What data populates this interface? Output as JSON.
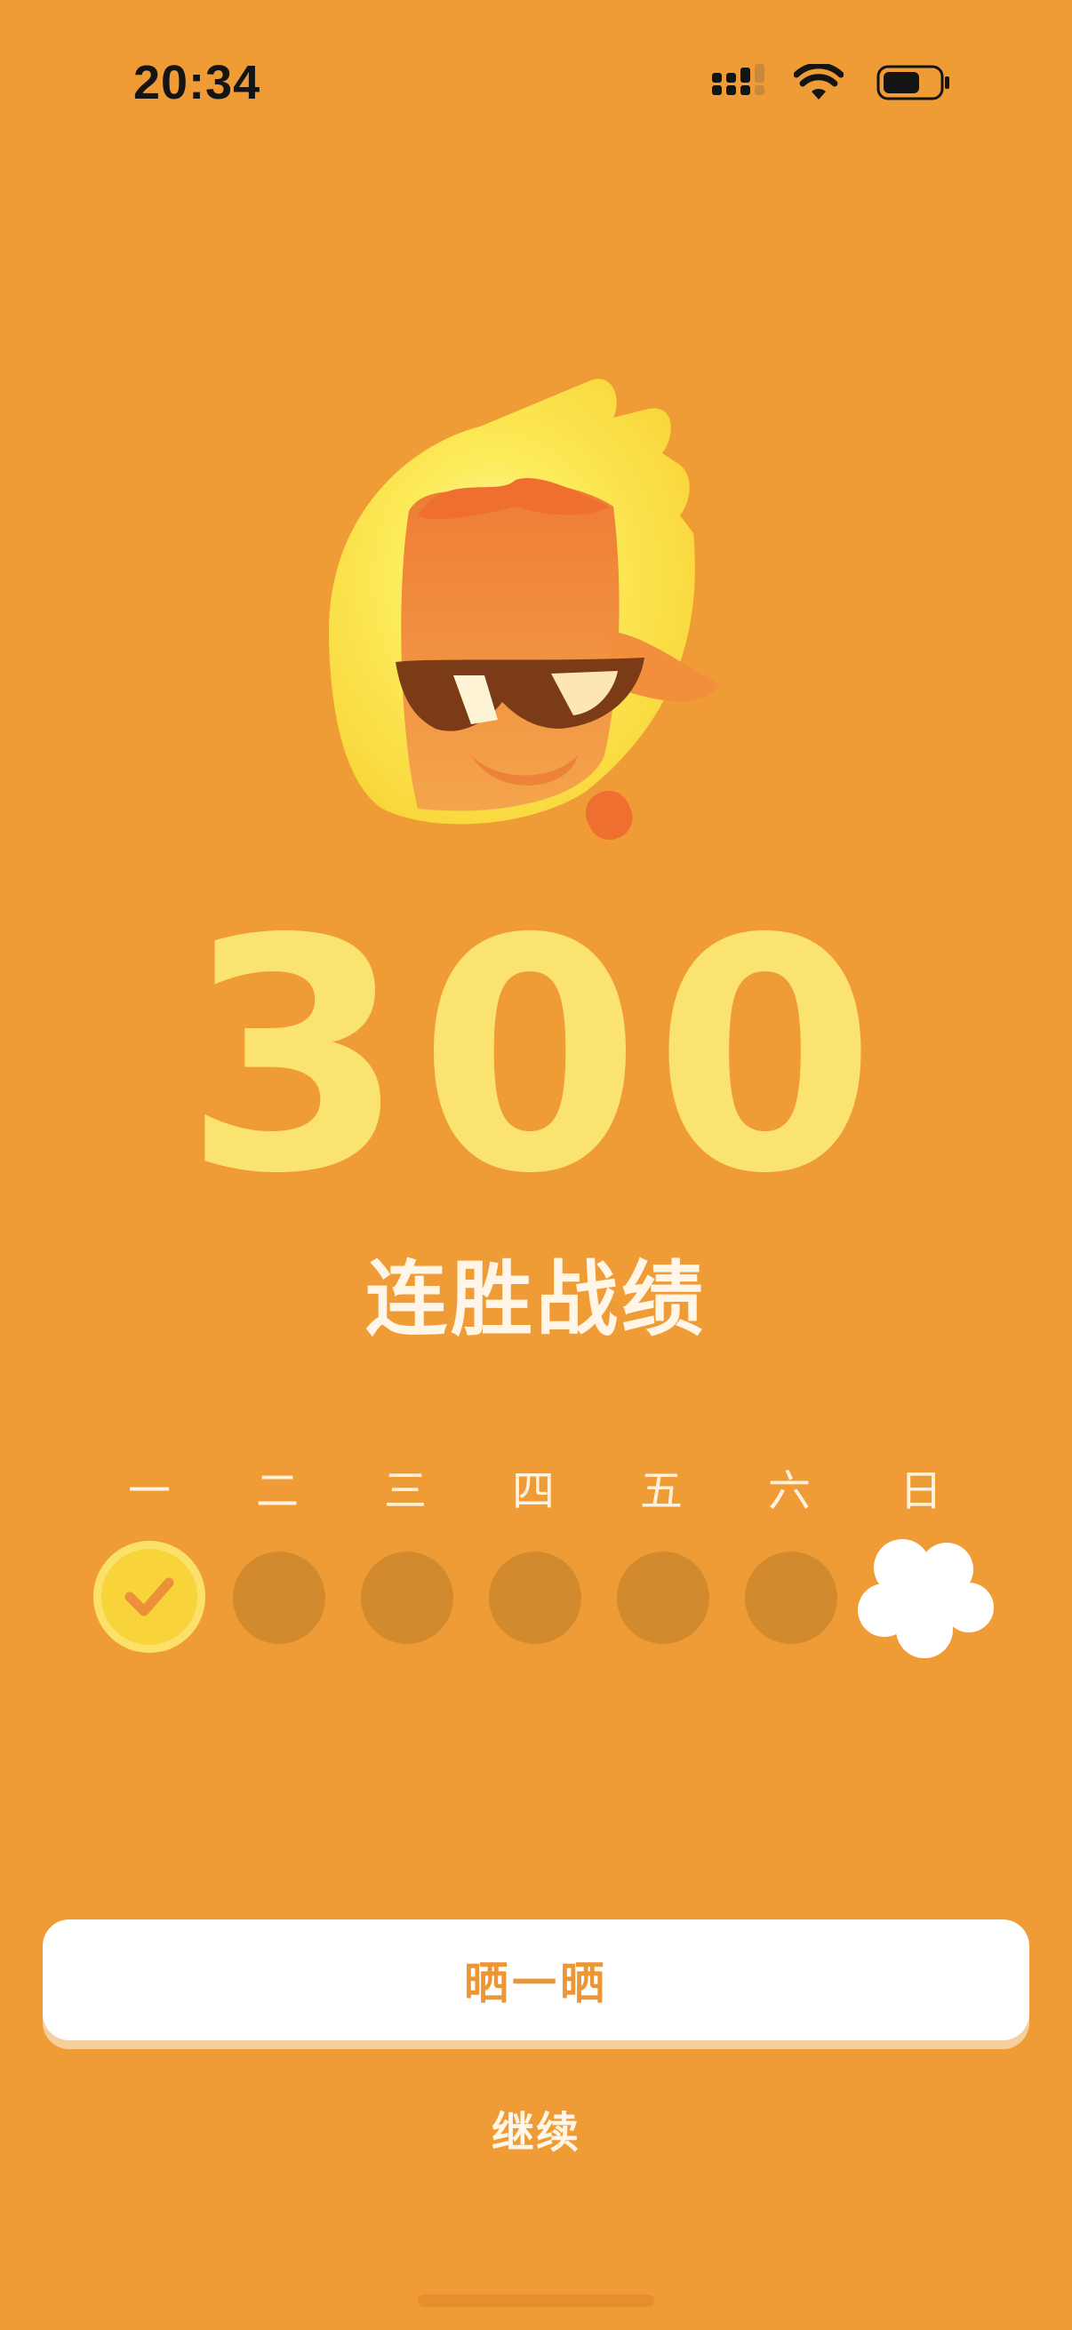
{
  "status_bar": {
    "time": "20:34",
    "icons": [
      "signal-icon",
      "wifi-icon",
      "battery-icon"
    ]
  },
  "mascot": {
    "name": "flame-owl-with-sunglasses"
  },
  "streak": {
    "number": "300",
    "label": "连胜战绩"
  },
  "week": {
    "days": [
      {
        "label": "一",
        "state": "done"
      },
      {
        "label": "二",
        "state": "empty"
      },
      {
        "label": "三",
        "state": "empty"
      },
      {
        "label": "四",
        "state": "empty"
      },
      {
        "label": "五",
        "state": "empty"
      },
      {
        "label": "六",
        "state": "empty"
      },
      {
        "label": "日",
        "state": "today"
      }
    ]
  },
  "actions": {
    "share_label": "晒一晒",
    "continue_label": "继续"
  },
  "colors": {
    "background": "#F09C36",
    "streak_number": "#FAE371",
    "day_done": "#F8D339",
    "day_empty": "#D18A2E",
    "button_text": "#EB9735"
  }
}
